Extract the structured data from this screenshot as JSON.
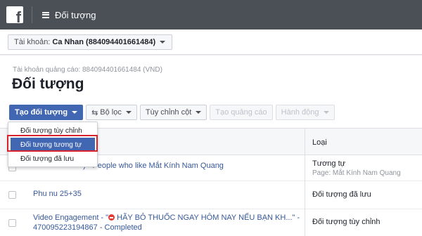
{
  "topbar": {
    "logo_letter": "f",
    "title": "Đối tượng"
  },
  "account": {
    "label": "Tài khoản:",
    "name": "Ca Nhan (884094401661484)"
  },
  "header": {
    "subtitle": "Tài khoản quảng cáo: 884094401661484 (VND)",
    "title": "Đối tượng"
  },
  "toolbar": {
    "create_audience": "Tạo đối tượng",
    "filter": "Bộ lọc",
    "customize_columns": "Tùy chỉnh cột",
    "create_ad": "Tạo quảng cáo",
    "actions": "Hành động"
  },
  "dropdown": {
    "items": [
      "Đối tượng tùy chỉnh",
      "Đối tượng tương tự",
      "Đối tượng đã lưu"
    ],
    "active_index": 1
  },
  "table": {
    "column_type": "Loại",
    "rows": [
      {
        "name": ") - People who like Mắt Kính Nam Quang",
        "type": "Tương tự",
        "type_sub": "Page: Mắt Kính Nam Quang"
      },
      {
        "name": "Phu nu 25+35",
        "type": "Đối tượng đã lưu",
        "type_sub": ""
      },
      {
        "name_prefix": "Video Engagement - \"",
        "name_rest": " HÃY BỎ THUỐC NGAY HÔM NAY NẾU BẠN KH...\" -",
        "name_line2": "470095223194867 - Completed",
        "type": "Đối tượng tùy chỉnh",
        "type_sub": ""
      }
    ]
  },
  "colors": {
    "topbar": "#4b4f56",
    "primary": "#4267b2",
    "link": "#365899",
    "highlight": "#d9232e"
  }
}
